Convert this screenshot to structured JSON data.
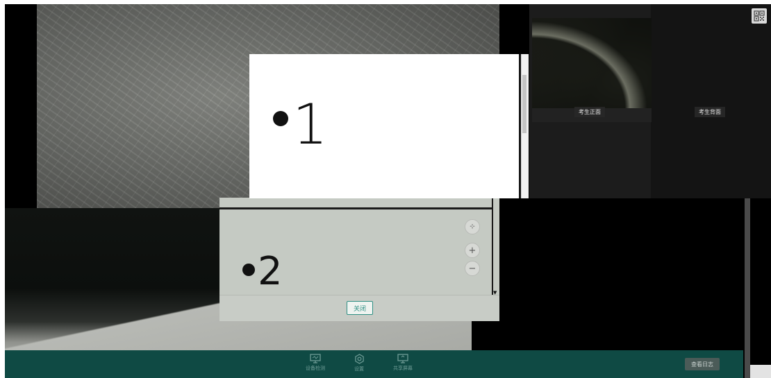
{
  "camera_labels": {
    "front": "考生正面",
    "back": "考生背面"
  },
  "front_dialog": {
    "text": "1"
  },
  "back_dialog": {
    "text": "2",
    "close_label": "关闭"
  },
  "zoom_controls": {
    "fit": "⊹",
    "zoom_in": "+",
    "zoom_out": "−"
  },
  "toolbar": {
    "items": [
      {
        "label": "设备检测",
        "icon": "monitor-icon"
      },
      {
        "label": "设置",
        "icon": "gear-icon"
      },
      {
        "label": "共享屏幕",
        "icon": "share-screen-icon"
      }
    ],
    "apply_label": "查看日志"
  },
  "icons": {
    "qr": "qr-code-icon"
  },
  "colors": {
    "toolbar_bg": "#0f4a44",
    "accent": "#2d8f83"
  }
}
